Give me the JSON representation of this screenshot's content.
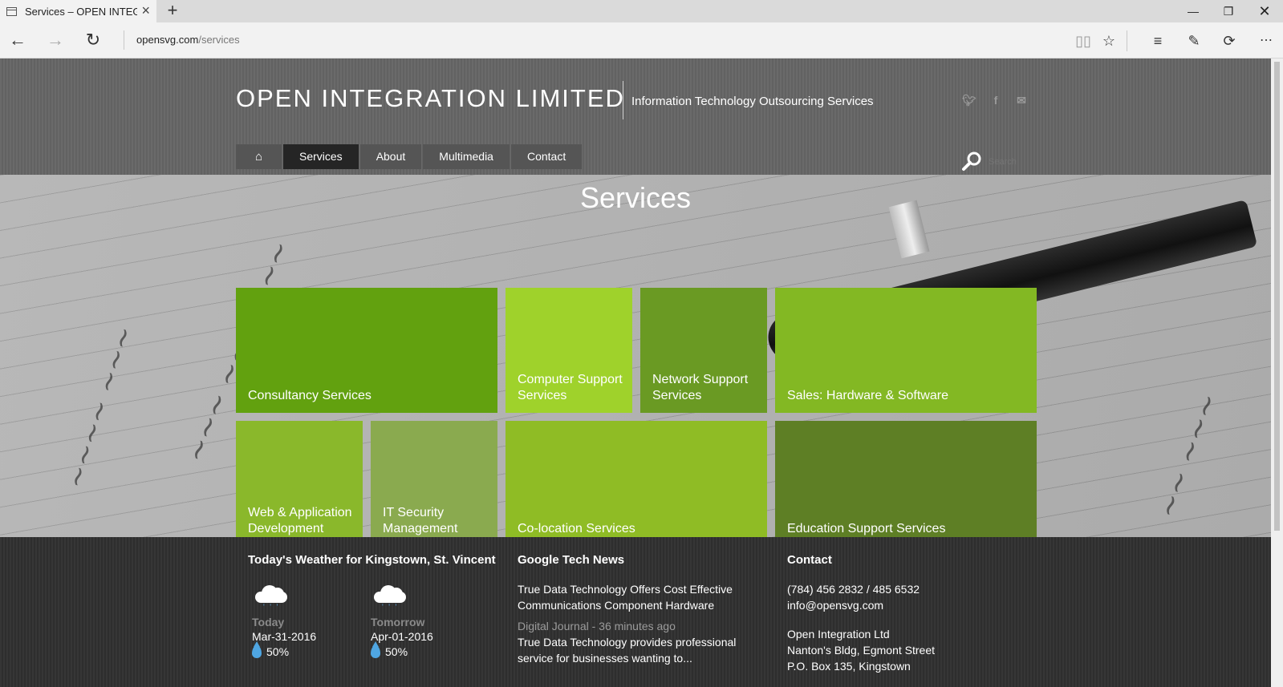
{
  "browser": {
    "tab_title": "Services – OPEN INTEGR",
    "url_host": "opensvg.com",
    "url_path": "/services"
  },
  "site": {
    "logo": "OPEN INTEGRATION LIMITED",
    "tagline": "Information Technology Outsourcing Services",
    "social": [
      "twitter-icon",
      "facebook-icon",
      "mail-icon"
    ],
    "nav": [
      {
        "label": "Services",
        "active": true
      },
      {
        "label": "About"
      },
      {
        "label": "Multimedia"
      },
      {
        "label": "Contact"
      }
    ],
    "search_placeholder": "Search"
  },
  "hero": {
    "title": "Services",
    "tiles": [
      {
        "label": "Consultancy Services",
        "color": "#62a10f"
      },
      {
        "label": "Computer Support Services",
        "color": "#9fd22b"
      },
      {
        "label": "Network Support Services",
        "color": "#6a9a23"
      },
      {
        "label": "Sales: Hardware & Software",
        "color": "#83b823"
      },
      {
        "label": "Web & Application Development",
        "color": "#8ab82b"
      },
      {
        "label": "IT Security Management",
        "color": "#8aaa4f"
      },
      {
        "label": "Co-location Services",
        "color": "#8fbc25"
      },
      {
        "label": "Education Support Services",
        "color": "#5e7f25"
      }
    ]
  },
  "footer": {
    "weather": {
      "title": "Today's Weather for Kingstown, St. Vincent",
      "days": [
        {
          "label": "Today",
          "date": "Mar-31-2016",
          "rain": "50%"
        },
        {
          "label": "Tomorrow",
          "date": "Apr-01-2016",
          "rain": "50%"
        }
      ]
    },
    "news": {
      "title": "Google Tech News",
      "items": [
        {
          "headline": "True Data Technology Offers Cost Effective Communications Component Hardware",
          "meta": "Digital Journal - 36 minutes ago"
        },
        {
          "headline": "True Data Technology provides professional service for businesses wanting to..."
        }
      ]
    },
    "contact": {
      "title": "Contact",
      "phone": "(784) 456 2832 / 485 6532",
      "email": "info@opensvg.com",
      "address": [
        "Open Integration Ltd",
        "Nanton's Bldg, Egmont Street",
        "P.O. Box 135, Kingstown"
      ]
    }
  }
}
